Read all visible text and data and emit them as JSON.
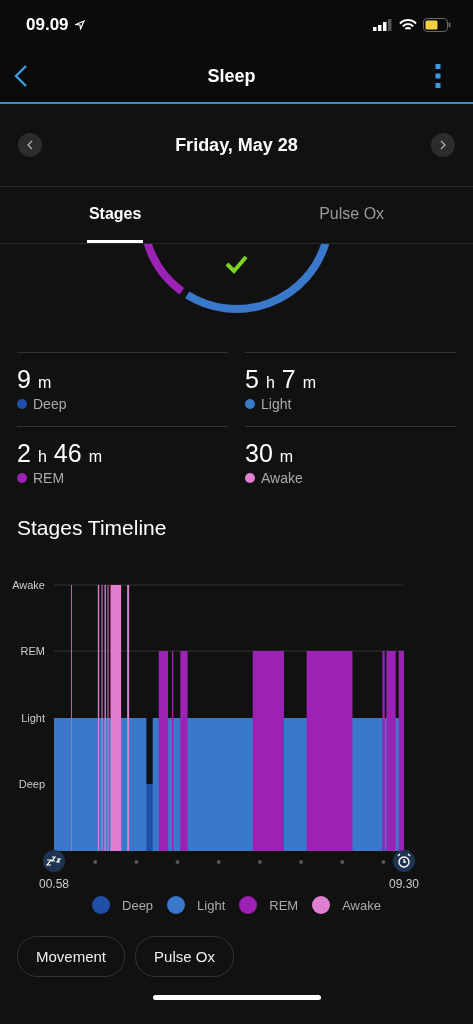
{
  "status_bar": {
    "time": "09.09"
  },
  "header": {
    "title": "Sleep"
  },
  "date_nav": {
    "date": "Friday, May 28"
  },
  "tabs": [
    {
      "label": "Stages",
      "selected": true
    },
    {
      "label": "Pulse Ox",
      "selected": false
    }
  ],
  "stats": [
    {
      "value": "9 m",
      "label": "Deep",
      "color": "#1f4fa8"
    },
    {
      "value": "5 h 7 m",
      "label": "Light",
      "color": "#3a78cc"
    },
    {
      "value": "2 h 46 m",
      "label": "REM",
      "color": "#9b22b5"
    },
    {
      "value": "30 m",
      "label": "Awake",
      "color": "#e07fcf"
    }
  ],
  "timeline": {
    "title": "Stages Timeline",
    "stage_labels": [
      "Awake",
      "REM",
      "Light",
      "Deep"
    ],
    "start_time": "00.58",
    "end_time": "09.30",
    "legend": [
      {
        "label": "Deep",
        "color": "#1f4fa8"
      },
      {
        "label": "Light",
        "color": "#3a78cc"
      },
      {
        "label": "REM",
        "color": "#9b22b5"
      },
      {
        "label": "Awake",
        "color": "#e07fcf"
      }
    ]
  },
  "buttons": [
    "Movement",
    "Pulse Ox"
  ]
}
